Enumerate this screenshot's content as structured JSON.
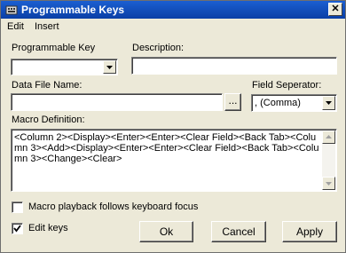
{
  "window": {
    "title": "Programmable Keys",
    "close_glyph": "✕"
  },
  "menu": {
    "items": [
      "Edit",
      "Insert"
    ]
  },
  "fields": {
    "programmable_key_label": "Programmable Key",
    "programmable_key_value": "",
    "description_label": "Description:",
    "description_value": "",
    "data_file_label": "Data File Name:",
    "data_file_value": "",
    "browse_label": "...",
    "field_separator_label": "Field Seperator:",
    "field_separator_value": ", (Comma)",
    "macro_label": "Macro Definition:",
    "macro_value": "<Column 2><Display><Enter><Enter><Clear Field><Back Tab><Column 3><Add><Display><Enter><Enter><Clear Field><Back Tab><Column 3><Change><Clear>"
  },
  "options": {
    "macro_playback_label": "Macro playback follows keyboard focus",
    "macro_playback_checked": false,
    "edit_keys_label": "Edit keys",
    "edit_keys_checked": true
  },
  "buttons": {
    "ok": "Ok",
    "cancel": "Cancel",
    "apply": "Apply"
  },
  "icons": {
    "app": "keyboard-icon",
    "close": "close-icon",
    "dropdown": "chevron-down-icon",
    "scroll_up": "scroll-up-icon",
    "scroll_down": "scroll-down-icon",
    "check": "checkmark-icon"
  }
}
